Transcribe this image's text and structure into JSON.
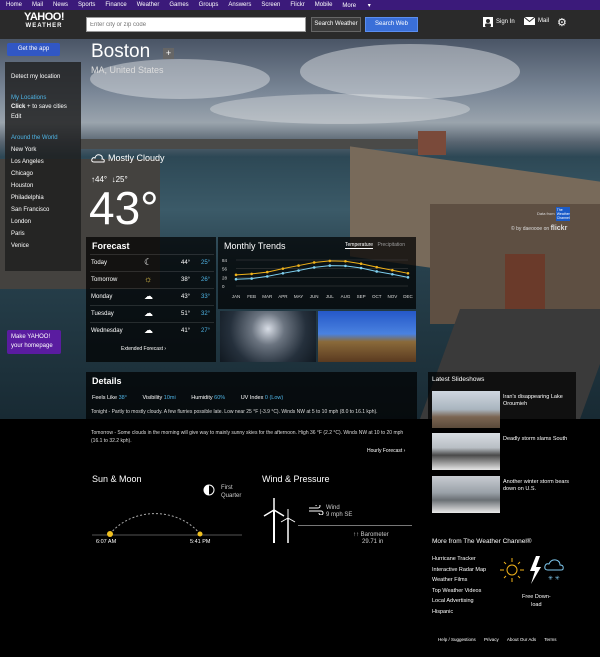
{
  "topnav": [
    "Home",
    "Mail",
    "News",
    "Sports",
    "Finance",
    "Weather",
    "Games",
    "Groups",
    "Answers",
    "Screen",
    "Flickr",
    "Mobile",
    "More"
  ],
  "header": {
    "logo_line1": "YAHOO!",
    "logo_line2": "WEATHER",
    "search_placeholder": "Enter city or zip code",
    "search_weather": "Search Weather",
    "search_web": "Search Web",
    "sign_in": "Sign In",
    "mail": "Mail"
  },
  "get_app": "Get the app",
  "sidebar": {
    "detect": "Detect my location",
    "my_locations": "My Locations",
    "click_hint": "Click",
    "click_hint_rest": "to save cities",
    "edit": "Edit",
    "around": "Around the World",
    "cities": [
      "New York",
      "Los Angeles",
      "Chicago",
      "Houston",
      "Philadelphia",
      "San Francisco",
      "London",
      "Paris",
      "Venice"
    ]
  },
  "make_yahoo": {
    "line1": "Make YAHOO!",
    "line2": "your homepage"
  },
  "location": {
    "city": "Boston",
    "region": "MA, United States"
  },
  "current": {
    "condition": "Mostly Cloudy",
    "high": "44°",
    "low": "25°",
    "temp": "43°"
  },
  "photo_credit": {
    "data_from": "Data from",
    "twc": "The Weather Channel",
    "by": "© by daeoooe on",
    "flickr": "flickr"
  },
  "forecast": {
    "title": "Forecast",
    "rows": [
      {
        "day": "Today",
        "icon": "partly-cloudy-night-icon",
        "glyph": "☾",
        "hi": "44°",
        "lo": "25°"
      },
      {
        "day": "Tomorrow",
        "icon": "partly-cloudy-icon",
        "glyph": "☼",
        "hi": "38°",
        "lo": "26°"
      },
      {
        "day": "Monday",
        "icon": "rain-cloud-icon",
        "glyph": "☁",
        "hi": "43°",
        "lo": "33°"
      },
      {
        "day": "Tuesday",
        "icon": "cloud-icon",
        "glyph": "☁",
        "hi": "51°",
        "lo": "32°"
      },
      {
        "day": "Wednesday",
        "icon": "cloud-icon",
        "glyph": "☁",
        "hi": "41°",
        "lo": "27°"
      }
    ],
    "extended": "Extended Forecast ›"
  },
  "trends": {
    "title": "Monthly Trends",
    "tab_temp": "Temperature",
    "tab_precip": "Precipitation"
  },
  "chart_data": {
    "type": "line",
    "categories": [
      "JAN",
      "FEB",
      "MAR",
      "APR",
      "MAY",
      "JUN",
      "JUL",
      "AUG",
      "SEP",
      "OCT",
      "NOV",
      "DEC"
    ],
    "series": [
      {
        "values": [
          36,
          39,
          45,
          56,
          66,
          76,
          81,
          80,
          72,
          61,
          51,
          41
        ],
        "color": "#f0b21a"
      },
      {
        "values": [
          22,
          24,
          31,
          41,
          50,
          60,
          66,
          65,
          58,
          47,
          38,
          28
        ],
        "color": "#7fd0f0"
      }
    ],
    "yticks": [
      "84",
      "56",
      "28",
      "0"
    ],
    "ylim": [
      0,
      84
    ]
  },
  "details": {
    "title": "Details",
    "feels_like_label": "Feels Like",
    "feels_like": "38°",
    "visibility_label": "Visibility",
    "visibility": "10mi",
    "humidity_label": "Humidity",
    "humidity": "60%",
    "uv_label": "UV Index",
    "uv": "0 (Low)",
    "tonight": "Tonight - Partly to mostly cloudy. A few flurries possible late. Low near 25 °F (-3.9 °C). Winds NW at 5 to 10 mph (8.0 to 16.1 kph).",
    "tomorrow": "Tomorrow - Some clouds in the morning will give way to mainly sunny skies for the afternoon. High 36 °F (2.2 °C). Winds NW at 10 to 20 mph (16.1 to 32.2 kph).",
    "hourly": "Hourly Forecast ›"
  },
  "slideshows": {
    "title": "Latest Slideshows",
    "items": [
      {
        "text": "Iran's disappearing Lake Oroumieh"
      },
      {
        "text": "Deadly storm slams South"
      },
      {
        "text": "Another winter storm bears down on U.S."
      }
    ]
  },
  "sun_moon": {
    "title": "Sun & Moon",
    "moon_line1": "First",
    "moon_line2": "Quarter",
    "sunrise": "6:07 AM",
    "sunset": "5:41 PM"
  },
  "wind_pressure": {
    "title": "Wind & Pressure",
    "wind_label": "Wind",
    "wind_value": "9 mph SE",
    "baro_label": "Barometer",
    "baro_value": "29.71",
    "baro_unit": "in"
  },
  "twc": {
    "title": "More from The Weather Channel®",
    "links": [
      "Hurricane Tracker",
      "Interactive Radar Map",
      "Weather Films",
      "Top Weather Videos",
      "Local Advertising",
      "Hispanic"
    ],
    "free_line1": "Free Down-",
    "free_line2": "load"
  },
  "footer": [
    "Help / Suggestions",
    "Privacy",
    "About Our Ads",
    "Terms"
  ]
}
